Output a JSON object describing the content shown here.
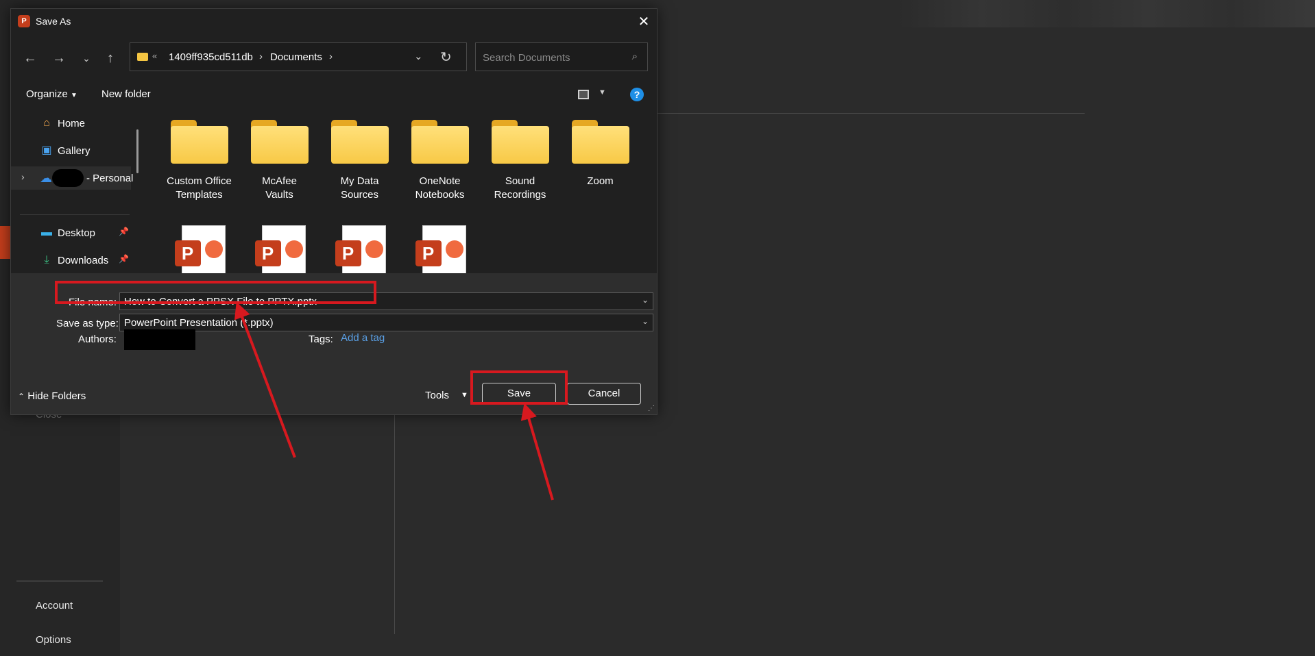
{
  "background": {
    "close_label": "Close",
    "account_label": "Account",
    "options_label": "Options"
  },
  "dialog": {
    "title": "Save As",
    "address": {
      "chevron": "«",
      "segments": [
        "1409ff935cd511db",
        "Documents"
      ]
    },
    "search": {
      "placeholder": "Search Documents"
    },
    "toolbar": {
      "organize_label": "Organize",
      "new_folder_label": "New folder",
      "help_label": "?"
    },
    "sidebar": {
      "items": [
        {
          "label": "Home"
        },
        {
          "label": "Gallery"
        },
        {
          "label": "- Personal"
        },
        {
          "label": "Desktop"
        },
        {
          "label": "Downloads"
        }
      ]
    },
    "files": {
      "folders": [
        {
          "label": "Custom Office Templates"
        },
        {
          "label": "McAfee Vaults"
        },
        {
          "label": "My Data Sources"
        },
        {
          "label": "OneNote Notebooks"
        },
        {
          "label": "Sound Recordings"
        },
        {
          "label": "Zoom"
        }
      ],
      "ppt_badge": "P"
    },
    "form": {
      "file_name_label": "File name:",
      "file_name_value": "How to Convert a PPSX File to PPTX.pptx",
      "save_type_label": "Save as type:",
      "save_type_value": "PowerPoint Presentation (*.pptx)",
      "authors_label": "Authors:",
      "tags_label": "Tags:",
      "add_tag_label": "Add a tag"
    },
    "footer": {
      "hide_folders_label": "Hide Folders",
      "tools_label": "Tools",
      "save_label": "Save",
      "cancel_label": "Cancel"
    }
  },
  "colors": {
    "annotation_red": "#d7191f",
    "accent_orange": "#c43e1c",
    "link_blue": "#5aa0e6"
  }
}
